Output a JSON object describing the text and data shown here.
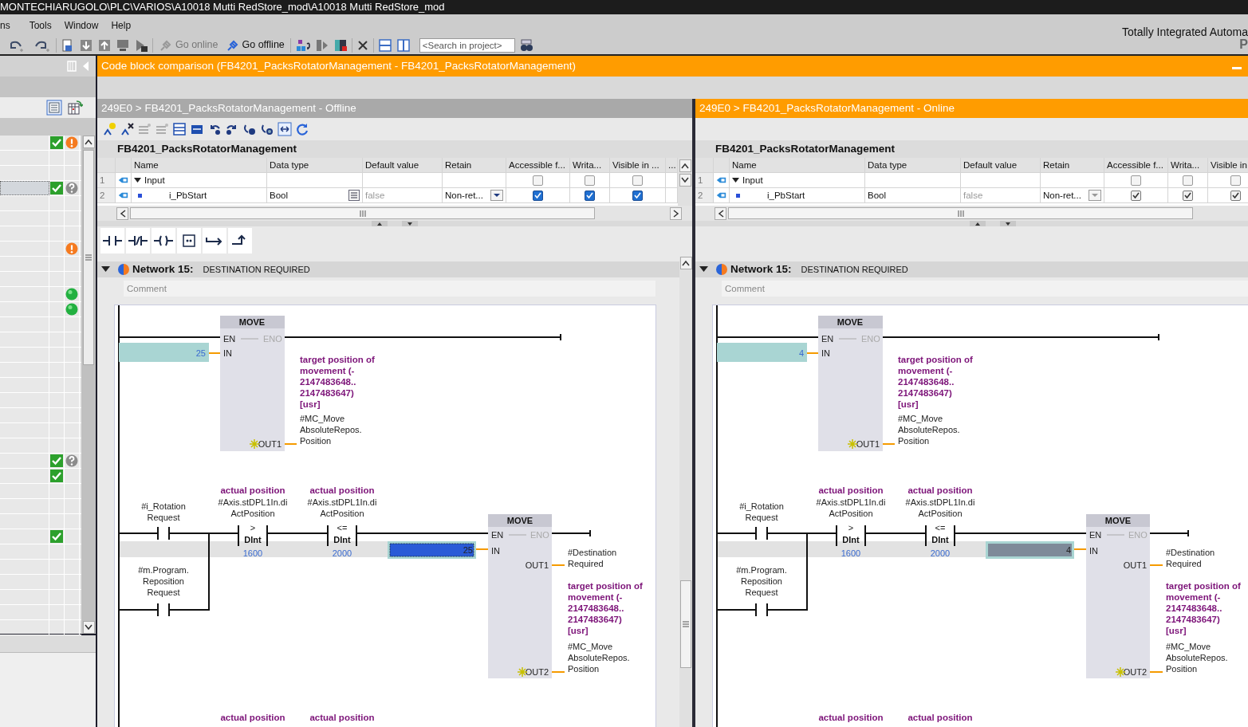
{
  "title_bar": {
    "path": "MONTECHIARUGOLO\\PLC\\VARIOS\\A10018 Mutti RedStore_mod\\A10018 Mutti RedStore_mod"
  },
  "menu": [
    "ns",
    "Tools",
    "Window",
    "Help"
  ],
  "toolbar": {
    "go_online": {
      "label": "Go online",
      "disabled": true
    },
    "go_offline": {
      "label": "Go offline",
      "disabled": false
    },
    "search": {
      "placeholder": "<Search in project>"
    }
  },
  "brand": {
    "title": "Totally Integrated Automa",
    "subtitle": "P"
  },
  "compare_list": {
    "rows": [
      {
        "compared": true,
        "warning": true,
        "unknown": false,
        "identical": false,
        "selected": false
      },
      {
        "compared": false,
        "warning": false,
        "unknown": false,
        "identical": false,
        "selected": false
      },
      {
        "compared": false,
        "warning": false,
        "unknown": false,
        "identical": false,
        "selected": false
      },
      {
        "compared": true,
        "warning": false,
        "unknown": true,
        "identical": false,
        "selected": true
      },
      {
        "compared": false,
        "warning": false,
        "unknown": false,
        "identical": false,
        "selected": false
      },
      {
        "compared": false,
        "warning": false,
        "unknown": false,
        "identical": false,
        "selected": false
      },
      {
        "compared": false,
        "warning": false,
        "unknown": false,
        "identical": false,
        "selected": false
      },
      {
        "compared": false,
        "warning": true,
        "unknown": false,
        "identical": false,
        "selected": false
      },
      {
        "compared": false,
        "warning": false,
        "unknown": false,
        "identical": false,
        "selected": false
      },
      {
        "compared": false,
        "warning": false,
        "unknown": false,
        "identical": false,
        "selected": false
      },
      {
        "compared": false,
        "warning": false,
        "unknown": false,
        "identical": true,
        "selected": false
      },
      {
        "compared": false,
        "warning": false,
        "unknown": false,
        "identical": true,
        "selected": false
      },
      {
        "compared": false,
        "warning": false,
        "unknown": false,
        "identical": false,
        "selected": false
      },
      {
        "compared": false,
        "warning": false,
        "unknown": false,
        "identical": false,
        "selected": false
      },
      {
        "compared": false,
        "warning": false,
        "unknown": false,
        "identical": false,
        "selected": false
      },
      {
        "compared": false,
        "warning": false,
        "unknown": false,
        "identical": false,
        "selected": false
      },
      {
        "compared": false,
        "warning": false,
        "unknown": false,
        "identical": false,
        "selected": false
      },
      {
        "compared": false,
        "warning": false,
        "unknown": false,
        "identical": false,
        "selected": false
      },
      {
        "compared": false,
        "warning": false,
        "unknown": false,
        "identical": false,
        "selected": false
      },
      {
        "compared": false,
        "warning": false,
        "unknown": false,
        "identical": false,
        "selected": false
      },
      {
        "compared": false,
        "warning": false,
        "unknown": false,
        "identical": false,
        "selected": false
      },
      {
        "compared": true,
        "warning": false,
        "unknown": true,
        "identical": false,
        "selected": false
      },
      {
        "compared": true,
        "warning": false,
        "unknown": false,
        "identical": false,
        "selected": false
      },
      {
        "compared": false,
        "warning": false,
        "unknown": false,
        "identical": false,
        "selected": false
      },
      {
        "compared": false,
        "warning": false,
        "unknown": false,
        "identical": false,
        "selected": false
      },
      {
        "compared": false,
        "warning": false,
        "unknown": false,
        "identical": false,
        "selected": false
      },
      {
        "compared": true,
        "warning": false,
        "unknown": false,
        "identical": false,
        "selected": false
      },
      {
        "compared": false,
        "warning": false,
        "unknown": false,
        "identical": false,
        "selected": false
      },
      {
        "compared": false,
        "warning": false,
        "unknown": false,
        "identical": false,
        "selected": false
      },
      {
        "compared": false,
        "warning": false,
        "unknown": false,
        "identical": false,
        "selected": false
      },
      {
        "compared": false,
        "warning": false,
        "unknown": false,
        "identical": false,
        "selected": false
      },
      {
        "compared": false,
        "warning": false,
        "unknown": false,
        "identical": false,
        "selected": false
      },
      {
        "compared": false,
        "warning": false,
        "unknown": false,
        "identical": false,
        "selected": false
      }
    ]
  },
  "editor": {
    "title": "Code block comparison (FB4201_PacksRotatorManagement - FB4201_PacksRotatorManagement)"
  },
  "panes": [
    {
      "header": "249E0 > FB4201_PacksRotatorManagement - Offline",
      "highlighted": false,
      "editable": true,
      "block_name": "FB4201_PacksRotatorManagement",
      "columns": [
        "Name",
        "Data type",
        "Default value",
        "Retain",
        "Accessible f...",
        "Writa...",
        "Visible in ...",
        "..."
      ],
      "rows": [
        {
          "kind": "section",
          "number": "1",
          "name": "Input",
          "expanded": true,
          "accessible": false,
          "writable": false,
          "visible": false
        },
        {
          "kind": "member",
          "number": "2",
          "name": "i_PbStart",
          "data_type": "Bool",
          "default_value": "false",
          "retain": "Non-ret...",
          "accessible": true,
          "writable": true,
          "visible": true
        }
      ],
      "network": {
        "title": "Network 15:",
        "subtitle": "DESTINATION REQUIRED",
        "comment": "Comment",
        "expanded": true
      },
      "ladder": {
        "rung1": {
          "block": {
            "title": "MOVE",
            "en": "EN",
            "eno": "ENO",
            "in": "IN",
            "out": "OUT1"
          },
          "in_value": "25",
          "out_comment": [
            "target position of",
            "movement (-",
            "2147483648..",
            "2147483647)",
            "[usr]"
          ],
          "out_operand": [
            "#MC_Move",
            "AbsoluteRepos.",
            "Position"
          ]
        },
        "rung2": {
          "contacts": [
            {
              "operand": [
                "#i_Rotation",
                "Request"
              ]
            },
            {
              "operand": [
                "#m.Program.",
                "Reposition",
                "Request"
              ]
            }
          ],
          "comparators": [
            {
              "comment": "actual position",
              "operand": [
                "#Axis.stDPL1In.di",
                "ActPosition"
              ],
              "operator": ">",
              "type": "DInt",
              "value": "1600"
            },
            {
              "comment": "actual position",
              "operand": [
                "#Axis.stDPL1In.di",
                "ActPosition"
              ],
              "operator": "<=",
              "type": "DInt",
              "value": "2000"
            }
          ],
          "block": {
            "title": "MOVE",
            "en": "EN",
            "eno": "ENO",
            "in": "IN",
            "out1": "OUT1",
            "out2": "OUT2"
          },
          "in_value": "25",
          "in_selected": true,
          "out1_operand": [
            "#Destination",
            "Required"
          ],
          "out2_comment": [
            "target position of",
            "movement (-",
            "2147483648..",
            "2147483647)",
            "[usr]"
          ],
          "out2_operand": [
            "#MC_Move",
            "AbsoluteRepos.",
            "Position"
          ]
        },
        "rung3_comments": [
          "actual position",
          "actual position"
        ]
      }
    },
    {
      "header": "249E0 > FB4201_PacksRotatorManagement - Online",
      "highlighted": true,
      "editable": false,
      "block_name": "FB4201_PacksRotatorManagement",
      "columns": [
        "Name",
        "Data type",
        "Default value",
        "Retain",
        "Accessible f...",
        "Writa...",
        "Visible in"
      ],
      "rows": [
        {
          "kind": "section",
          "number": "1",
          "name": "Input",
          "expanded": true,
          "accessible": false,
          "writable": false,
          "visible": false
        },
        {
          "kind": "member",
          "number": "2",
          "name": "i_PbStart",
          "data_type": "Bool",
          "default_value": "false",
          "retain": "Non-ret...",
          "accessible": true,
          "writable": true,
          "visible": true
        }
      ],
      "network": {
        "title": "Network 15:",
        "subtitle": "DESTINATION REQUIRED",
        "comment": "Comment",
        "expanded": true
      },
      "ladder": {
        "rung1": {
          "block": {
            "title": "MOVE",
            "en": "EN",
            "eno": "ENO",
            "in": "IN",
            "out": "OUT1"
          },
          "in_value": "4",
          "out_comment": [
            "target position of",
            "movement (-",
            "2147483648..",
            "2147483647)",
            "[usr]"
          ],
          "out_operand": [
            "#MC_Move",
            "AbsoluteRepos.",
            "Position"
          ]
        },
        "rung2": {
          "contacts": [
            {
              "operand": [
                "#i_Rotation",
                "Request"
              ]
            },
            {
              "operand": [
                "#m.Program.",
                "Reposition",
                "Request"
              ]
            }
          ],
          "comparators": [
            {
              "comment": "actual position",
              "operand": [
                "#Axis.stDPL1In.di",
                "ActPosition"
              ],
              "operator": ">",
              "type": "DInt",
              "value": "1600"
            },
            {
              "comment": "actual position",
              "operand": [
                "#Axis.stDPL1In.di",
                "ActPosition"
              ],
              "operator": "<=",
              "type": "DInt",
              "value": "2000"
            }
          ],
          "block": {
            "title": "MOVE",
            "en": "EN",
            "eno": "ENO",
            "in": "IN",
            "out1": "OUT1",
            "out2": "OUT2"
          },
          "in_value": "4",
          "in_selected": false,
          "out1_operand": [
            "#Destination",
            "Required"
          ],
          "out2_comment": [
            "target position of",
            "movement (-",
            "2147483648..",
            "2147483647)",
            "[usr]"
          ],
          "out2_operand": [
            "#MC_Move",
            "AbsoluteRepos.",
            "Position"
          ]
        },
        "rung3_comments": [
          "actual position",
          "actual position"
        ]
      }
    }
  ]
}
